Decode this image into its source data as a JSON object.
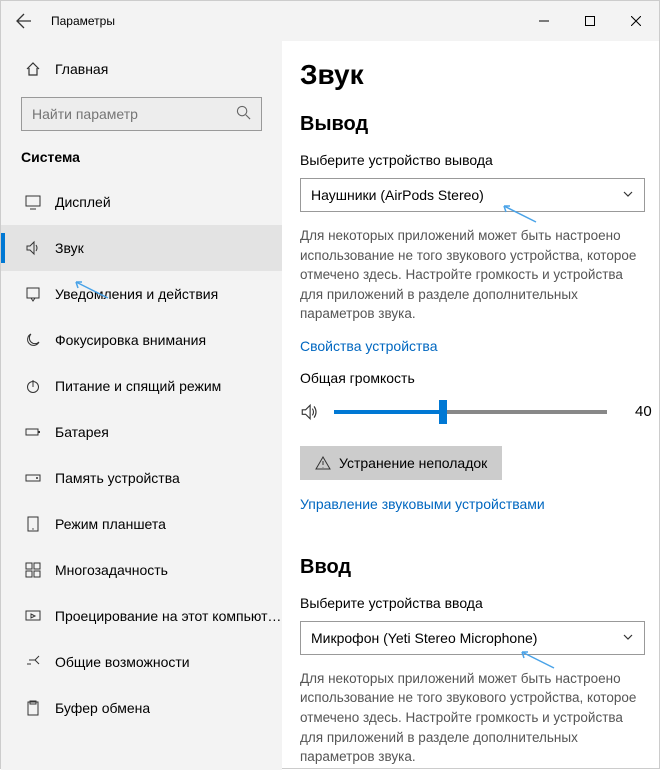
{
  "window": {
    "title": "Параметры"
  },
  "sidebar": {
    "home": "Главная",
    "search_placeholder": "Найти параметр",
    "category": "Система",
    "items": [
      {
        "label": "Дисплей"
      },
      {
        "label": "Звук"
      },
      {
        "label": "Уведомления и действия"
      },
      {
        "label": "Фокусировка внимания"
      },
      {
        "label": "Питание и спящий режим"
      },
      {
        "label": "Батарея"
      },
      {
        "label": "Память устройства"
      },
      {
        "label": "Режим планшета"
      },
      {
        "label": "Многозадачность"
      },
      {
        "label": "Проецирование на этот компьютер"
      },
      {
        "label": "Общие возможности"
      },
      {
        "label": "Буфер обмена"
      }
    ]
  },
  "page": {
    "heading": "Звук",
    "output": {
      "title": "Вывод",
      "select_label": "Выберите устройство вывода",
      "selected": "Наушники (AirPods Stereo)",
      "help": "Для некоторых приложений может быть настроено использование не того звукового устройства, которое отмечено здесь. Настройте громкость и устройства для приложений в разделе дополнительных параметров звука.",
      "props_link": "Свойства устройства",
      "vol_label": "Общая громкость",
      "vol_value": "40",
      "trouble_btn": "Устранение неполадок",
      "manage_link": "Управление звуковыми устройствами"
    },
    "input": {
      "title": "Ввод",
      "select_label": "Выберите устройства ввода",
      "selected": "Микрофон (Yeti Stereo Microphone)",
      "help": "Для некоторых приложений может быть настроено использование не того звукового устройства, которое отмечено здесь. Настройте громкость и устройства для приложений в разделе дополнительных параметров звука."
    }
  }
}
